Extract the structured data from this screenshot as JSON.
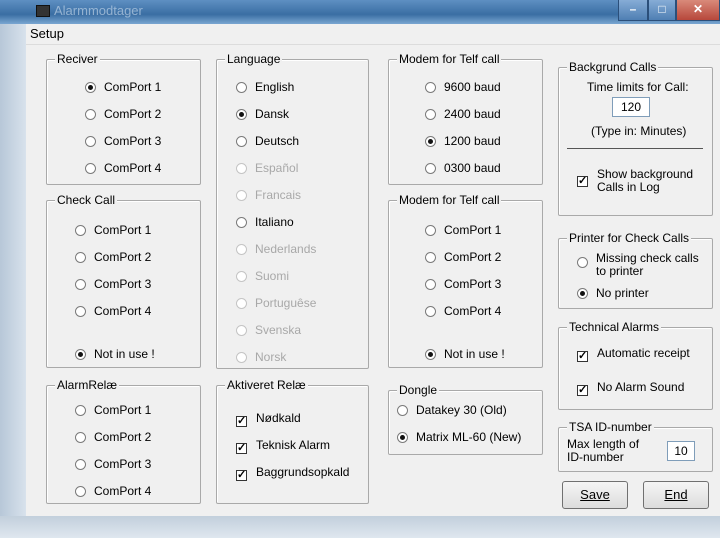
{
  "window": {
    "title": "Alarmmodtager"
  },
  "menu": {
    "setup": "Setup"
  },
  "reciver": {
    "title": "Reciver",
    "options": [
      "ComPort 1",
      "ComPort 2",
      "ComPort 3",
      "ComPort 4"
    ],
    "selected": 0
  },
  "check_call": {
    "title": "Check Call",
    "options": [
      "ComPort 1",
      "ComPort 2",
      "ComPort 3",
      "ComPort 4",
      "Not in use !"
    ],
    "selected": 4
  },
  "alarm_relae": {
    "title": "AlarmRelæ",
    "options": [
      "ComPort 1",
      "ComPort 2",
      "ComPort 3",
      "ComPort 4"
    ]
  },
  "language": {
    "title": "Language",
    "options": [
      "English",
      "Dansk",
      "Deutsch",
      "Español",
      "Francais",
      "Italiano",
      "Nederlands",
      "Suomi",
      "Portuguêse",
      "Svenska",
      "Norsk"
    ],
    "selected": 1
  },
  "aktiveret_relae": {
    "title": "Aktiveret Relæ",
    "options": [
      "Nødkald",
      "Teknisk Alarm",
      "Baggrundsopkald"
    ]
  },
  "modem_baud": {
    "title": "Modem for Telf call",
    "options": [
      "9600 baud",
      "2400 baud",
      "1200 baud",
      "0300 baud"
    ],
    "selected": 2
  },
  "modem_port": {
    "title": "Modem for Telf call",
    "options": [
      "ComPort 1",
      "ComPort 2",
      "ComPort 3",
      "ComPort 4",
      "Not in use !"
    ],
    "selected": 4
  },
  "dongle": {
    "title": "Dongle",
    "options": [
      "Datakey 30 (Old)",
      "Matrix ML-60 (New)"
    ],
    "selected": 1
  },
  "background_calls": {
    "title": "Backgrund Calls",
    "time_label": "Time limits for Call:",
    "time_value": "120",
    "hint": "(Type in: Minutes)",
    "show_log_line1": "Show background",
    "show_log_line2": "Calls in Log"
  },
  "printer": {
    "title": "Printer for Check Calls",
    "missing_line1": "Missing check calls",
    "missing_line2": "to printer",
    "no_printer": "No printer"
  },
  "technical": {
    "title": "Technical Alarms",
    "auto_receipt": "Automatic receipt",
    "no_sound": "No Alarm Sound"
  },
  "tsa": {
    "title": "TSA ID-number",
    "max_line1": "Max length of",
    "max_line2": "ID-number",
    "value": "10"
  },
  "buttons": {
    "save": "Save",
    "end": "End"
  }
}
